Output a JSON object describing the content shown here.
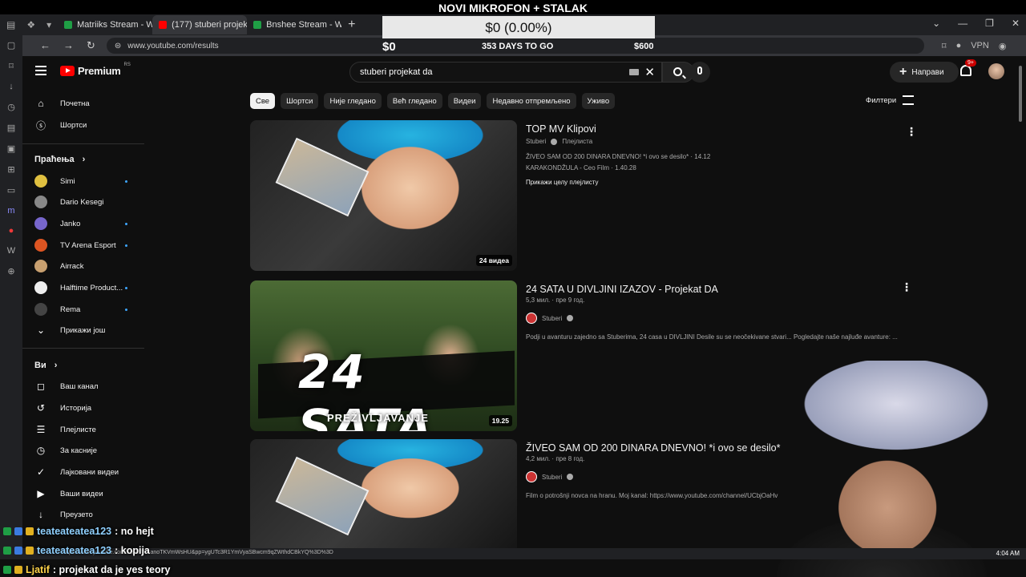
{
  "overlay": {
    "stream_title": "NOVI MIKROFON + STALAK",
    "goal_value": "$0 (0.00%)",
    "goal_start": "$0",
    "goal_days": "353 DAYS TO GO",
    "goal_target": "$600"
  },
  "browser": {
    "tabs": [
      {
        "label": "Matriiks Stream - Watch Li",
        "color": "#1f9e45"
      },
      {
        "label": "(177) stuberi projekat da -",
        "color": "#ff0000"
      },
      {
        "label": "Bnshee Stream - Watch Liv",
        "color": "#1f9e45"
      }
    ],
    "url": "www.youtube.com/results",
    "status_url": "https://www.youtube.com/watch?v=anoTKVmWsHU&pp=ygUTc3R1YmVyaSBwcm9qZWthdCBkYQ%3D%3D",
    "clock": "4:04 AM"
  },
  "header": {
    "logo_word": "Premium",
    "logo_region": "RS",
    "search_query": "stuberi projekat da",
    "create_label": "Направи",
    "notif_count": "9+"
  },
  "sidebar": {
    "home": "Почетна",
    "shorts": "Шортси",
    "subs_header": "Праћења",
    "channels": [
      {
        "name": "Simi",
        "dot": true,
        "color": "#e0c040"
      },
      {
        "name": "Dario Kesegi",
        "dot": false,
        "color": "#888"
      },
      {
        "name": "Janko",
        "dot": true,
        "color": "#7766cc"
      },
      {
        "name": "TV Arena Esport",
        "dot": true,
        "color": "#dd5522"
      },
      {
        "name": "Airrack",
        "dot": false,
        "color": "#c8a070"
      },
      {
        "name": "Halftime Product...",
        "dot": true,
        "color": "#eeeeee"
      },
      {
        "name": "Rema",
        "dot": true,
        "color": "#444"
      }
    ],
    "show_more": "Прикажи још",
    "you_header": "Ви",
    "you_items": [
      {
        "label": "Ваш канал",
        "icon": "channel-icon",
        "glyph": "◻"
      },
      {
        "label": "Историја",
        "icon": "history-icon",
        "glyph": "↺"
      },
      {
        "label": "Плејлисте",
        "icon": "playlists-icon",
        "glyph": "☰"
      },
      {
        "label": "За касније",
        "icon": "clock-icon",
        "glyph": "◷"
      },
      {
        "label": "Лајковани видеи",
        "icon": "like-icon",
        "glyph": "👍"
      },
      {
        "label": "Ваши видеи",
        "icon": "video-icon",
        "glyph": "▶"
      },
      {
        "label": "Преузето",
        "icon": "download-icon",
        "glyph": "↓"
      }
    ]
  },
  "chips": [
    "Све",
    "Шортси",
    "Није гледано",
    "Већ гледано",
    "Видеи",
    "Недавно отпремљено",
    "Уживо"
  ],
  "filters_label": "Филтери",
  "results": [
    {
      "title": "TOP MV Klipovi",
      "channel": "Stuberi",
      "type": "Плејлиста",
      "line1": "ŽIVEO SAM OD 200 DINARA DNEVNO! *i ovo se desilo* · 14.12",
      "line2": "KARAKONDŽULA - Ceo Film · 1.40.28",
      "more": "Прикажи целу плејлисту",
      "duration": "24 видеа"
    },
    {
      "title": "24 SATA U DIVLJINI IZAZOV - Projekat DA",
      "meta": "5,3 мил. · пре 9 год.",
      "channel": "Stuberi",
      "desc": "Podji u avanturu zajedno sa Stuberima, 24 casa u DIVLJINI Desile su se neočekivane stvari... Pogledajte naše najluđe avanture: ...",
      "duration": "19.25",
      "thumb_big": "24 SATA",
      "thumb_sub": "PREŽIVLJAVANJE"
    },
    {
      "title": "ŽIVEO SAM OD 200 DINARA DNEVNO! *i ovo se desilo*",
      "meta": "4,2 мил. · пре 8 год.",
      "channel": "Stuberi",
      "desc": "Film o potrošnji novca na hranu. Moj kanal: https://www.youtube.com/channel/UCbjOaHv"
    }
  ],
  "chat": [
    {
      "user": "teateateatea123",
      "msg": ": no hejt"
    },
    {
      "user": "teateateatea123",
      "msg": ": kopija"
    },
    {
      "user": "Ljatif",
      "msg": ": projekat da je yes teory"
    }
  ]
}
